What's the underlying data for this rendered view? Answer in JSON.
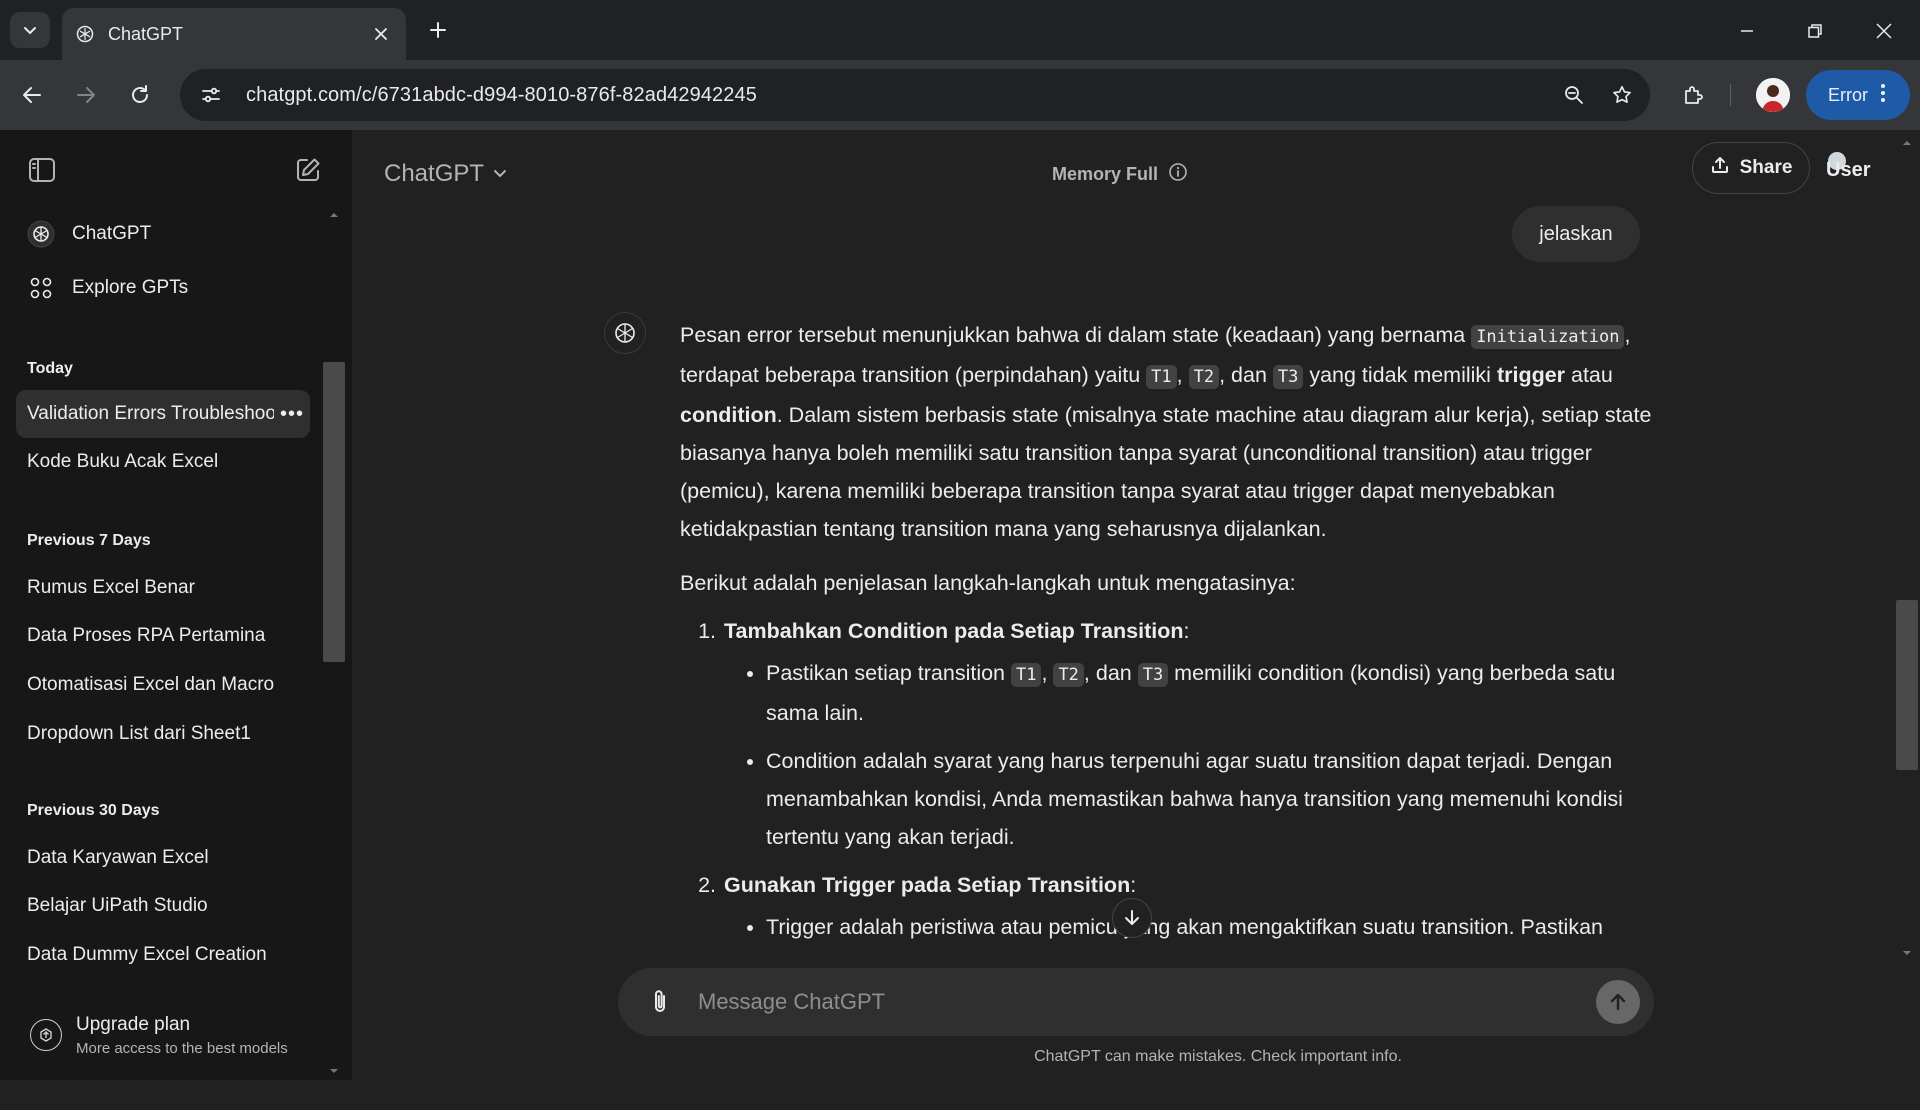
{
  "browser": {
    "tab_title": "ChatGPT",
    "url": "chatgpt.com/c/6731abdc-d994-8010-876f-82ad42942245",
    "error_label": "Error"
  },
  "sidebar": {
    "top_items": [
      {
        "label": "ChatGPT",
        "icon": "openai-logo-icon"
      },
      {
        "label": "Explore GPTs",
        "icon": "grid-icon"
      }
    ],
    "sections": [
      {
        "title": "Today",
        "items": [
          "Validation Errors Troubleshoo",
          "Kode Buku Acak Excel"
        ]
      },
      {
        "title": "Previous 7 Days",
        "items": [
          "Rumus Excel Benar",
          "Data Proses RPA Pertamina",
          "Otomatisasi Excel dan Macro",
          "Dropdown List dari Sheet1"
        ]
      },
      {
        "title": "Previous 30 Days",
        "items": [
          "Data Karyawan Excel",
          "Belajar UiPath Studio",
          "Data Dummy Excel Creation"
        ]
      }
    ],
    "upgrade": {
      "title": "Upgrade plan",
      "subtitle": "More access to the best models"
    }
  },
  "header": {
    "model": "ChatGPT",
    "memory": "Memory Full",
    "share": "Share",
    "user": "User"
  },
  "conversation": {
    "user_message": "jelaskan",
    "assistant": {
      "p1": {
        "a": "Pesan error tersebut menunjukkan bahwa di dalam state (keadaan) yang bernama ",
        "code1": "Initialization",
        "b": ", terdapat beberapa transition (perpindahan) yaitu ",
        "t1": "T1",
        "sep1": ", ",
        "t2": "T2",
        "sep2": ", dan ",
        "t3": "T3",
        "c": " yang tidak memiliki ",
        "bold1": "trigger",
        "d": " atau ",
        "bold2": "condition",
        "e": ". Dalam sistem berbasis state (misalnya state machine atau diagram alur kerja), setiap state biasanya hanya boleh memiliki satu transition tanpa syarat (unconditional transition) atau trigger (pemicu), karena memiliki beberapa transition tanpa syarat atau trigger dapat menyebabkan ketidakpastian tentang transition mana yang seharusnya dijalankan."
      },
      "p2": "Berikut adalah penjelasan langkah-langkah untuk mengatasinya:",
      "step1": {
        "title": "Tambahkan Condition pada Setiap Transition",
        "colon": ":",
        "b1_a": "Pastikan setiap transition ",
        "b1_t1": "T1",
        "b1_sep1": ", ",
        "b1_t2": "T2",
        "b1_sep2": ", dan ",
        "b1_t3": "T3",
        "b1_b": " memiliki condition (kondisi) yang berbeda satu sama lain.",
        "b2": "Condition adalah syarat yang harus terpenuhi agar suatu transition dapat terjadi. Dengan menambahkan kondisi, Anda memastikan bahwa hanya transition yang memenuhi kondisi tertentu yang akan terjadi."
      },
      "step2": {
        "title": "Gunakan Trigger pada Setiap Transition",
        "colon": ":",
        "b1": "Trigger adalah peristiwa atau pemicu yang akan mengaktifkan suatu transition. Pastikan"
      }
    }
  },
  "composer": {
    "placeholder": "Message ChatGPT"
  },
  "footer": "ChatGPT can make mistakes. Check important info."
}
